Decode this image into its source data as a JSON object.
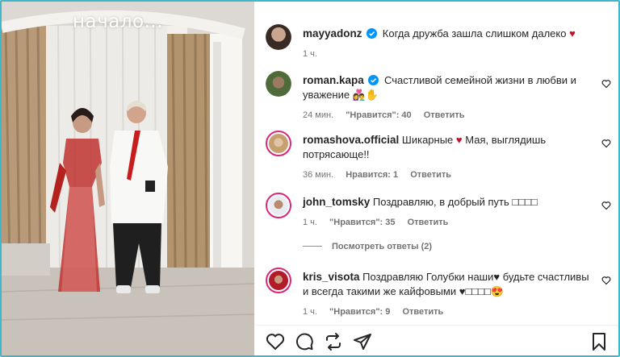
{
  "photo": {
    "overlay_text": "начало..."
  },
  "post": {
    "author": "mayyadonz",
    "caption": "Когда дружба зашла слишком далеко",
    "caption_emoji": "♥",
    "time": "1 ч."
  },
  "comments": [
    {
      "username": "roman.kapa",
      "verified": true,
      "text": "Счастливой семейной жизни в любви и уважение 👩‍❤️‍👨✋",
      "time": "24 мин.",
      "likes": "\"Нравится\": 40",
      "reply": "Ответить"
    },
    {
      "username": "romashova.official",
      "verified": false,
      "text_before": "Шикарные",
      "text_after": "Мая, выглядишь потрясающе!!",
      "time": "36 мин.",
      "likes": "Нравится: 1",
      "reply": "Ответить"
    },
    {
      "username": "john_tomsky",
      "verified": false,
      "text": "Поздравляю, в добрый путь □□□□",
      "time": "1 ч.",
      "likes": "\"Нравится\": 35",
      "reply": "Ответить"
    },
    {
      "username": "kris_visota",
      "verified": false,
      "text": "Поздравляю Голубки наши♥ будьте счастливы и всегда такими же кайфовыми ♥□□□□😍",
      "time": "1 ч.",
      "likes": "\"Нравится\": 9",
      "reply": "Ответить"
    }
  ],
  "view_replies": "Посмотреть ответы (2)",
  "icons": {
    "like": "heart-icon",
    "comment": "comment-icon",
    "share": "repost-icon",
    "send": "send-icon",
    "save": "bookmark-icon"
  },
  "colors": {
    "verified": "#0095f6",
    "ring": "#d9267a",
    "heart": "#c8102e",
    "frame": "#3fb6c9"
  }
}
